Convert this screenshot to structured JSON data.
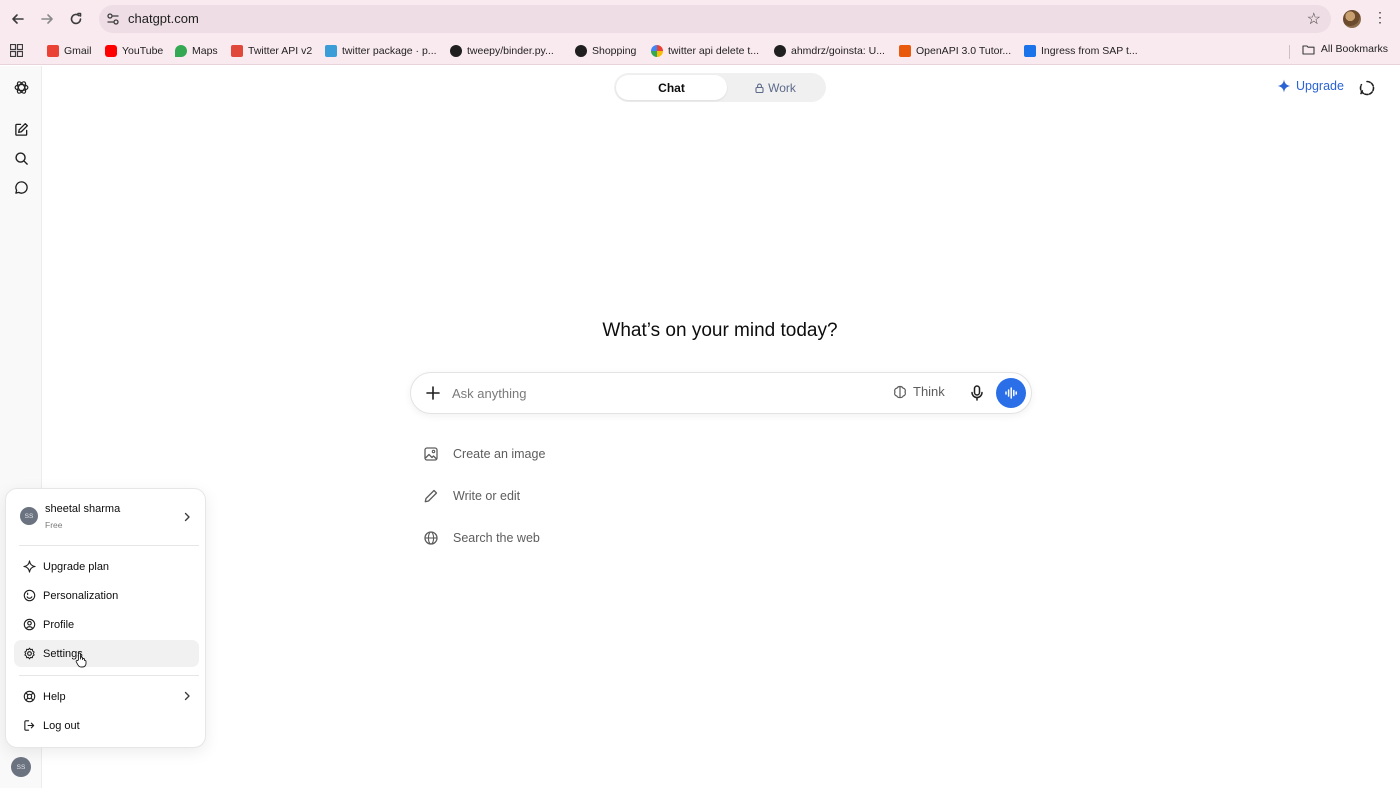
{
  "browser": {
    "url": "chatgpt.com",
    "bookmarks": [
      {
        "label": "Gmail",
        "icon": "gmail-icon",
        "color": "#ea4335"
      },
      {
        "label": "YouTube",
        "icon": "youtube-icon",
        "color": "#ff0000"
      },
      {
        "label": "Maps",
        "icon": "maps-pin-icon",
        "color": "#34a853"
      },
      {
        "label": "Twitter API v2",
        "icon": "twitter-api-icon",
        "color": "#e0483a"
      },
      {
        "label": "twitter package · p...",
        "icon": "package-icon",
        "color": "#3b9dd8"
      },
      {
        "label": "tweepy/binder.py...",
        "icon": "github-icon",
        "color": "#1f1f1f"
      },
      {
        "label": "Shopping",
        "icon": "globe-icon",
        "color": "#1f1f1f"
      },
      {
        "label": "twitter api delete t...",
        "icon": "google-icon",
        "color": "#4285f4"
      },
      {
        "label": "ahmdrz/goinsta: U...",
        "icon": "github-icon",
        "color": "#1f1f1f"
      },
      {
        "label": "OpenAPI 3.0 Tutor...",
        "icon": "openapi-icon",
        "color": "#e8590c"
      },
      {
        "label": "Ingress from SAP t...",
        "icon": "sap-icon",
        "color": "#1a73e8"
      }
    ],
    "all_bookmarks_label": "All Bookmarks"
  },
  "header": {
    "tabs": [
      {
        "label": "Chat",
        "active": true
      },
      {
        "label": "Work",
        "active": false,
        "icon": "lock-icon"
      }
    ],
    "upgrade_label": "Upgrade",
    "accent_color": "#2a63d4"
  },
  "main": {
    "headline": "What’s on your mind today?",
    "composer": {
      "placeholder": "Ask anything",
      "think_label": "Think",
      "voice_color": "#2a6fe8"
    },
    "suggestions": [
      {
        "label": "Create an image",
        "icon": "image-icon"
      },
      {
        "label": "Write or edit",
        "icon": "pencil-icon"
      },
      {
        "label": "Search the web",
        "icon": "globe-icon"
      }
    ]
  },
  "account_menu": {
    "avatar_initials": "SS",
    "user_name": "sheetal sharma",
    "plan": "Free",
    "items": [
      {
        "label": "Upgrade plan",
        "icon": "sparkle-icon"
      },
      {
        "label": "Personalization",
        "icon": "personalization-icon"
      },
      {
        "label": "Profile",
        "icon": "profile-icon"
      },
      {
        "label": "Settings",
        "icon": "gear-icon",
        "hovered": true
      }
    ],
    "footer_items": [
      {
        "label": "Help",
        "icon": "lifebuoy-icon",
        "has_submenu": true
      },
      {
        "label": "Log out",
        "icon": "logout-icon"
      }
    ]
  }
}
